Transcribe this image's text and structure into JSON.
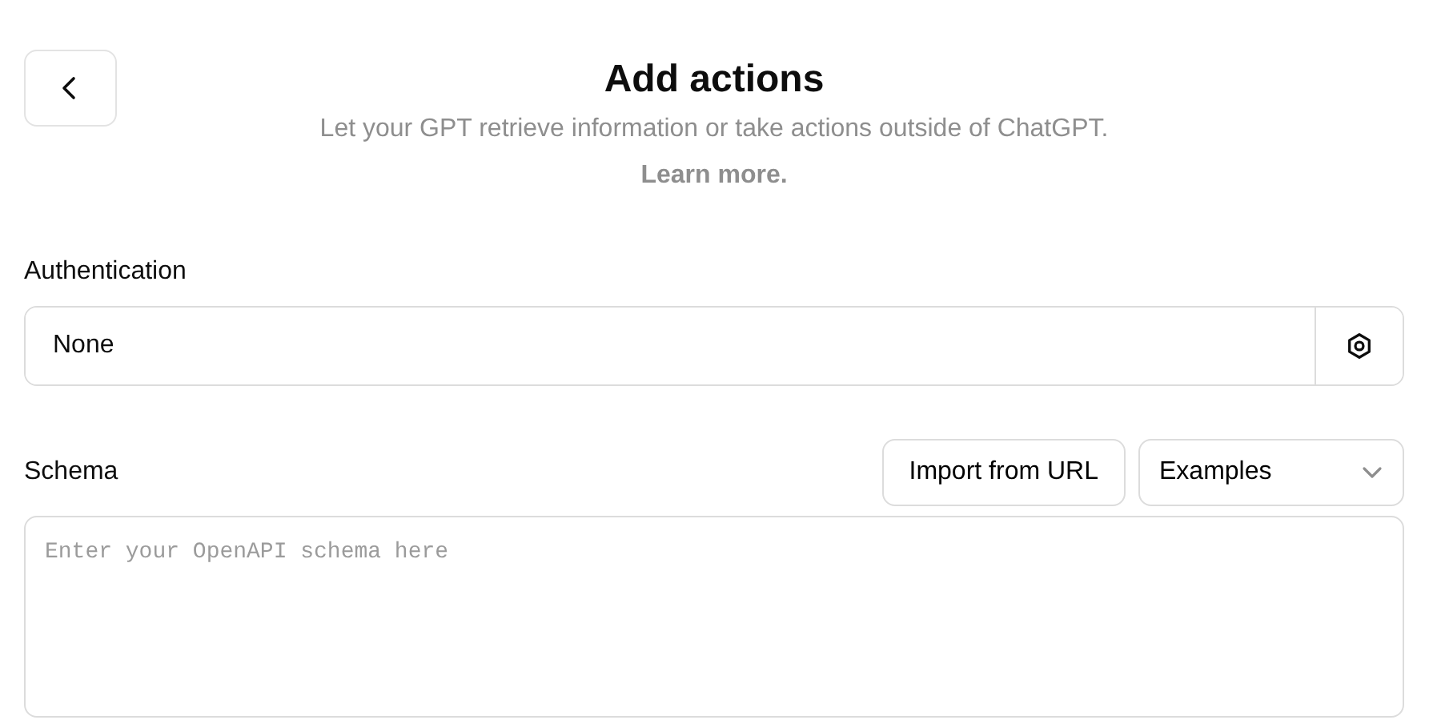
{
  "header": {
    "title": "Add actions",
    "subtitle": "Let your GPT retrieve information or take actions outside of ChatGPT.",
    "link": "Learn more."
  },
  "authentication": {
    "label": "Authentication",
    "value": "None"
  },
  "schema": {
    "label": "Schema",
    "import_button": "Import from URL",
    "examples_select": "Examples",
    "placeholder": "Enter your OpenAPI schema here"
  }
}
